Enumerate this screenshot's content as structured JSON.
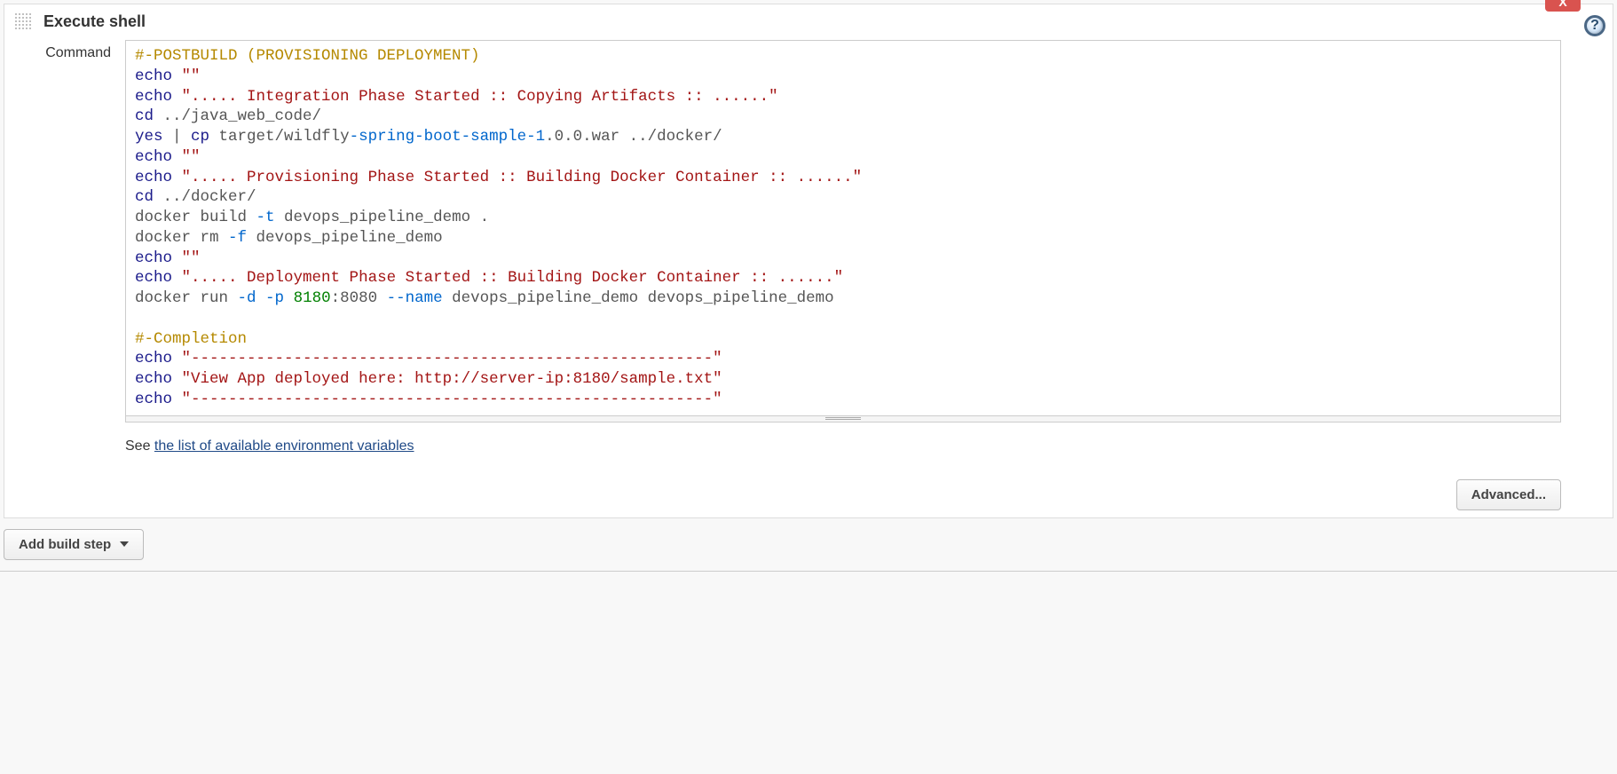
{
  "section": {
    "title": "Execute shell",
    "commandLabel": "Command",
    "deleteLabel": "X",
    "helpLabel": "?"
  },
  "shell": {
    "tokens": [
      {
        "t": "#-POSTBUILD (PROVISIONING DEPLOYMENT)",
        "c": "c-comment"
      },
      {
        "t": "\n"
      },
      {
        "t": "echo",
        "c": "c-cmd"
      },
      {
        "t": " "
      },
      {
        "t": "\"\"",
        "c": "c-str"
      },
      {
        "t": "\n"
      },
      {
        "t": "echo",
        "c": "c-cmd"
      },
      {
        "t": " "
      },
      {
        "t": "\"..... Integration Phase Started :: Copying Artifacts :: ......\"",
        "c": "c-str"
      },
      {
        "t": "\n"
      },
      {
        "t": "cd",
        "c": "c-cmd"
      },
      {
        "t": " ../java_web_code/",
        "c": "c-text"
      },
      {
        "t": "\n"
      },
      {
        "t": "yes",
        "c": "c-cmd"
      },
      {
        "t": " | ",
        "c": "c-op"
      },
      {
        "t": "cp",
        "c": "c-cmd"
      },
      {
        "t": " target/wildfly",
        "c": "c-text"
      },
      {
        "t": "-spring-boot-sample-1",
        "c": "c-opt"
      },
      {
        "t": ".0.0.war ../docker/",
        "c": "c-text"
      },
      {
        "t": "\n"
      },
      {
        "t": "echo",
        "c": "c-cmd"
      },
      {
        "t": " "
      },
      {
        "t": "\"\"",
        "c": "c-str"
      },
      {
        "t": "\n"
      },
      {
        "t": "echo",
        "c": "c-cmd"
      },
      {
        "t": " "
      },
      {
        "t": "\"..... Provisioning Phase Started :: Building Docker Container :: ......\"",
        "c": "c-str"
      },
      {
        "t": "\n"
      },
      {
        "t": "cd",
        "c": "c-cmd"
      },
      {
        "t": " ../docker/",
        "c": "c-text"
      },
      {
        "t": "\n"
      },
      {
        "t": "docker build ",
        "c": "c-text"
      },
      {
        "t": "-t",
        "c": "c-opt"
      },
      {
        "t": " devops_pipeline_demo .",
        "c": "c-text"
      },
      {
        "t": "\n"
      },
      {
        "t": "docker rm ",
        "c": "c-text"
      },
      {
        "t": "-f",
        "c": "c-opt"
      },
      {
        "t": " devops_pipeline_demo",
        "c": "c-text"
      },
      {
        "t": "\n"
      },
      {
        "t": "echo",
        "c": "c-cmd"
      },
      {
        "t": " "
      },
      {
        "t": "\"\"",
        "c": "c-str"
      },
      {
        "t": "\n"
      },
      {
        "t": "echo",
        "c": "c-cmd"
      },
      {
        "t": " "
      },
      {
        "t": "\"..... Deployment Phase Started :: Building Docker Container :: ......\"",
        "c": "c-str"
      },
      {
        "t": "\n"
      },
      {
        "t": "docker run ",
        "c": "c-text"
      },
      {
        "t": "-d -p",
        "c": "c-opt"
      },
      {
        "t": " "
      },
      {
        "t": "8180",
        "c": "c-num"
      },
      {
        "t": ":8080 ",
        "c": "c-text"
      },
      {
        "t": "--name",
        "c": "c-opt"
      },
      {
        "t": " devops_pipeline_demo devops_pipeline_demo",
        "c": "c-text"
      },
      {
        "t": "\n"
      },
      {
        "t": "\n"
      },
      {
        "t": "#-Completion",
        "c": "c-comment"
      },
      {
        "t": "\n"
      },
      {
        "t": "echo",
        "c": "c-cmd"
      },
      {
        "t": " "
      },
      {
        "t": "\"--------------------------------------------------------\"",
        "c": "c-str"
      },
      {
        "t": "\n"
      },
      {
        "t": "echo",
        "c": "c-cmd"
      },
      {
        "t": " "
      },
      {
        "t": "\"View App deployed here: http://server-ip:8180/sample.txt\"",
        "c": "c-str"
      },
      {
        "t": "\n"
      },
      {
        "t": "echo",
        "c": "c-cmd"
      },
      {
        "t": " "
      },
      {
        "t": "\"--------------------------------------------------------\"",
        "c": "c-str"
      }
    ]
  },
  "helper": {
    "prefix": "See ",
    "linkText": "the list of available environment variables"
  },
  "buttons": {
    "advanced": "Advanced...",
    "addBuildStep": "Add build step"
  }
}
